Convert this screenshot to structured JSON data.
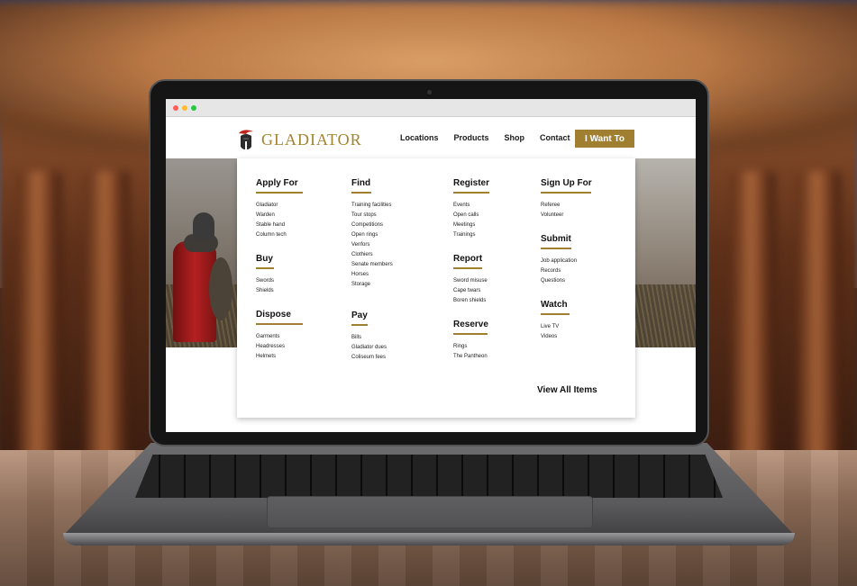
{
  "brand": {
    "name": "GLADIATOR",
    "accent_color": "#a08030"
  },
  "window": {
    "controls": [
      "close",
      "minimize",
      "maximize"
    ],
    "colors": [
      "#ff5f57",
      "#febc2e",
      "#28c840"
    ]
  },
  "nav": {
    "items": [
      "Locations",
      "Products",
      "Shop",
      "Contact"
    ],
    "cta_label": "I Want To"
  },
  "menu": {
    "apply_for": {
      "title": "Apply For",
      "items": [
        "Gladiator",
        "Warden",
        "Stable hand",
        "Column tech"
      ]
    },
    "buy": {
      "title": "Buy",
      "items": [
        "Swords",
        "Shields"
      ]
    },
    "dispose": {
      "title": "Dispose",
      "items": [
        "Garments",
        "Headresses",
        "Helmets"
      ]
    },
    "find": {
      "title": "Find",
      "items": [
        "Training facilities",
        "Tour stops",
        "Competitions",
        "Open rings",
        "Venfors",
        "Clothiers",
        "Senate members",
        "Horses",
        "Storage"
      ]
    },
    "pay": {
      "title": "Pay",
      "items": [
        "Bills",
        "Gladiator dues",
        "Coliseum fees"
      ]
    },
    "register": {
      "title": "Register",
      "items": [
        "Events",
        "Open calls",
        "Meetings",
        "Trainings"
      ]
    },
    "report": {
      "title": "Report",
      "items": [
        "Sword misuse",
        "Cape twars",
        "Boren shields"
      ]
    },
    "reserve": {
      "title": "Reserve",
      "items": [
        "Rings",
        "The Pantheon"
      ]
    },
    "sign_up_for": {
      "title": "Sign Up For",
      "items": [
        "Referee",
        "Volunteer"
      ]
    },
    "submit": {
      "title": "Submit",
      "items": [
        "Job application",
        "Records",
        "Questions"
      ]
    },
    "watch": {
      "title": "Watch",
      "items": [
        "Live TV",
        "Videos"
      ]
    },
    "view_all_label": "View All Items"
  }
}
